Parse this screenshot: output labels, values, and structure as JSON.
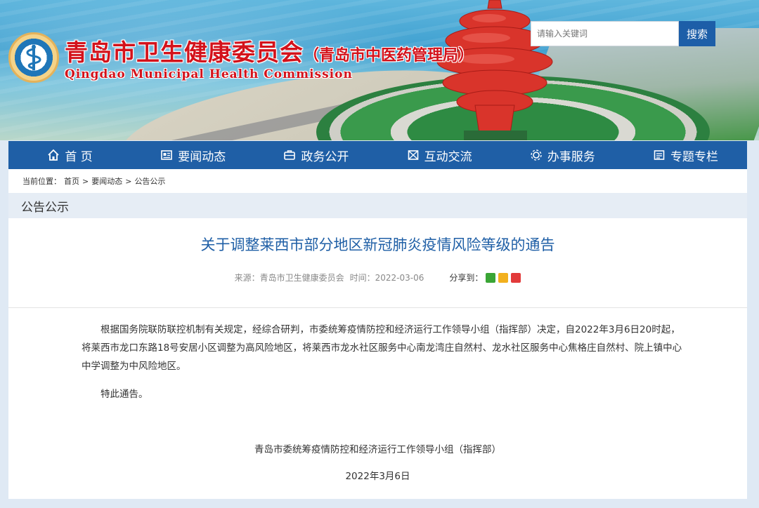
{
  "header": {
    "title_cn": "青岛市卫生健康委员会",
    "title_sub": "（青岛市中医药管理局）",
    "title_en": "Qingdao Municipal Health Commission"
  },
  "search": {
    "placeholder": "请输入关键词",
    "button_label": "搜索"
  },
  "nav": {
    "items": [
      {
        "label": "首 页",
        "icon": "home-icon"
      },
      {
        "label": "要闻动态",
        "icon": "news-icon"
      },
      {
        "label": "政务公开",
        "icon": "briefcase-icon"
      },
      {
        "label": "互动交流",
        "icon": "interact-icon"
      },
      {
        "label": "办事服务",
        "icon": "service-icon"
      },
      {
        "label": "专题专栏",
        "icon": "topic-icon"
      }
    ]
  },
  "breadcrumb": {
    "prefix": "当前位置：",
    "items": [
      "首页",
      "要闻动态",
      "公告公示"
    ],
    "separator": ">"
  },
  "section": {
    "title": "公告公示"
  },
  "article": {
    "title": "关于调整莱西市部分地区新冠肺炎疫情风险等级的通告",
    "source": "来源：青岛市卫生健康委员会",
    "time": "时间：2022-03-06",
    "share_label": "分享到：",
    "paragraph1": "根据国务院联防联控机制有关规定，经综合研判，市委统筹疫情防控和经济运行工作领导小组（指挥部）决定，自2022年3月6日20时起，将莱西市龙口东路18号安居小区调整为高风险地区，将莱西市龙水社区服务中心南龙湾庄自然村、龙水社区服务中心焦格庄自然村、院上镇中心中学调整为中风险地区。",
    "paragraph2": "特此通告。",
    "signature": "青岛市委统筹疫情防控和经济运行工作领导小组（指挥部）",
    "date": "2022年3月6日"
  },
  "colors": {
    "nav_bg": "#1f5fa6",
    "title_red": "#d3121b",
    "article_title": "#1f5fa6"
  }
}
